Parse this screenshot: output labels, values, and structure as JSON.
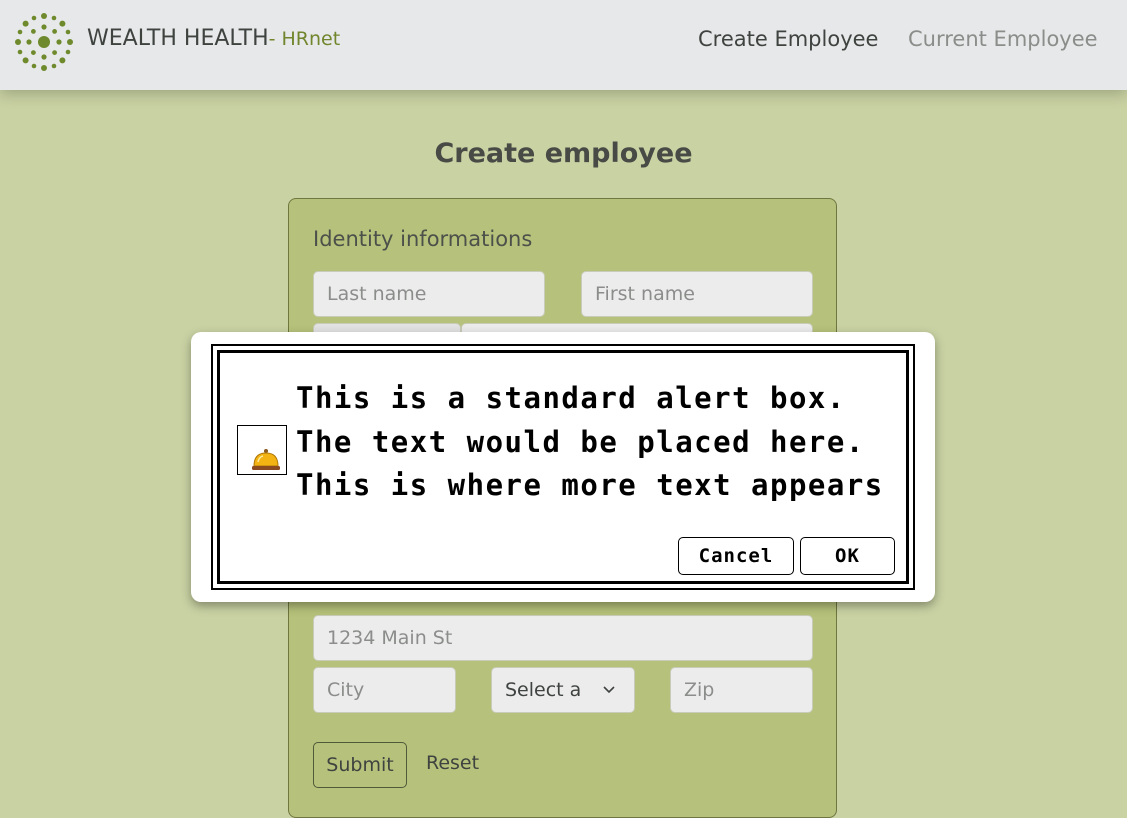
{
  "header": {
    "brand_name": "WEALTH HEALTH",
    "brand_sub": "- HRnet",
    "logo_icon": "leaf-wreath-logo",
    "nav": [
      {
        "label": "Create Employee",
        "active": true
      },
      {
        "label": "Current Employee",
        "active": false
      }
    ]
  },
  "main": {
    "title": "Create employee",
    "form": {
      "section_identity": "Identity informations",
      "last_name_placeholder": "Last name",
      "first_name_placeholder": "First name",
      "street_placeholder": "1234 Main St",
      "city_placeholder": "City",
      "state_selected": "Select a",
      "zip_placeholder": "Zip",
      "submit_label": "Submit",
      "reset_label": "Reset"
    }
  },
  "modal": {
    "icon": "service-bell-icon",
    "message": "This is a standard alert box. The text would be placed here. This is where more text appears",
    "cancel_label": "Cancel",
    "ok_label": "OK"
  },
  "colors": {
    "page_bg": "#c9d2a3",
    "card_bg": "#b6c27b",
    "accent": "#71862c",
    "header_bg": "#e7e8e9"
  }
}
